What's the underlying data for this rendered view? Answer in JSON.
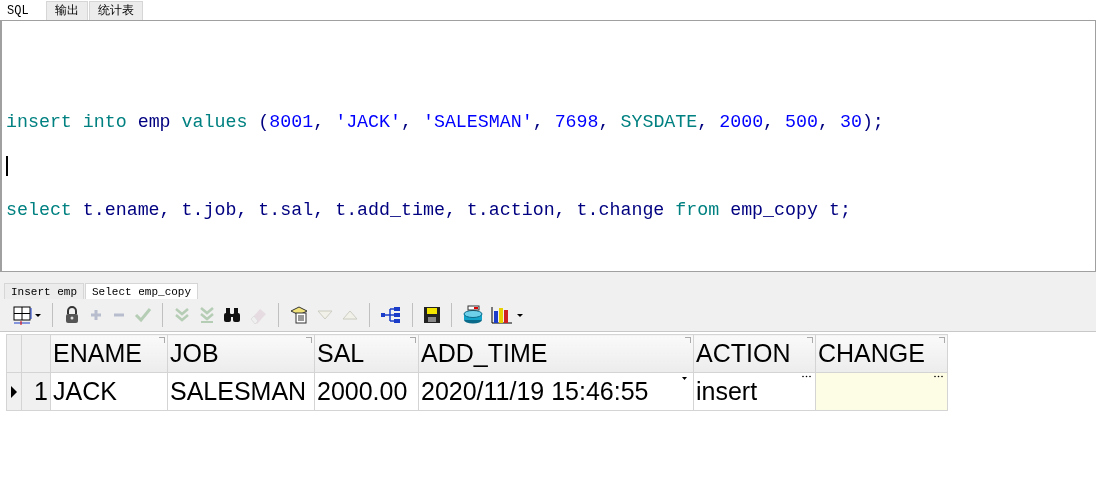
{
  "editor_tabs": [
    {
      "label": "SQL",
      "selected": true
    },
    {
      "label": "输出",
      "selected": false
    },
    {
      "label": "统计表",
      "selected": false
    }
  ],
  "editor": {
    "lines": [
      {
        "cursor": false,
        "tokens": [
          {
            "kind": "keyword",
            "text": "insert "
          },
          {
            "kind": "keyword",
            "text": "into "
          },
          {
            "kind": "ident",
            "text": "emp "
          },
          {
            "kind": "keyword",
            "text": "values "
          },
          {
            "kind": "punct",
            "text": "("
          },
          {
            "kind": "number",
            "text": "8001"
          },
          {
            "kind": "punct",
            "text": ", "
          },
          {
            "kind": "string",
            "text": "'JACK'"
          },
          {
            "kind": "punct",
            "text": ", "
          },
          {
            "kind": "string",
            "text": "'SALESMAN'"
          },
          {
            "kind": "punct",
            "text": ", "
          },
          {
            "kind": "number",
            "text": "7698"
          },
          {
            "kind": "punct",
            "text": ", "
          },
          {
            "kind": "keyword",
            "text": "SYSDATE"
          },
          {
            "kind": "punct",
            "text": ", "
          },
          {
            "kind": "number",
            "text": "2000"
          },
          {
            "kind": "punct",
            "text": ", "
          },
          {
            "kind": "number",
            "text": "500"
          },
          {
            "kind": "punct",
            "text": ", "
          },
          {
            "kind": "number",
            "text": "30"
          },
          {
            "kind": "punct",
            "text": ");"
          }
        ]
      },
      {
        "cursor": false
      },
      {
        "cursor": true
      },
      {
        "cursor": false
      },
      {
        "cursor": false,
        "tokens": [
          {
            "kind": "keyword",
            "text": "select "
          },
          {
            "kind": "ident",
            "text": "t.ename"
          },
          {
            "kind": "punct",
            "text": ", "
          },
          {
            "kind": "ident",
            "text": "t.job"
          },
          {
            "kind": "punct",
            "text": ", "
          },
          {
            "kind": "ident",
            "text": "t.sal"
          },
          {
            "kind": "punct",
            "text": ", "
          },
          {
            "kind": "ident",
            "text": "t.add_time"
          },
          {
            "kind": "punct",
            "text": ", "
          },
          {
            "kind": "ident",
            "text": "t.action"
          },
          {
            "kind": "punct",
            "text": ", "
          },
          {
            "kind": "ident",
            "text": "t.change "
          },
          {
            "kind": "keyword",
            "text": "from "
          },
          {
            "kind": "ident",
            "text": "emp_copy t"
          },
          {
            "kind": "punct",
            "text": ";"
          }
        ]
      }
    ]
  },
  "result_tabs": [
    {
      "label": "Insert emp",
      "selected": false
    },
    {
      "label": "Select emp_copy",
      "selected": true
    }
  ],
  "toolbar": [
    {
      "kind": "grid-menu",
      "disabled": false
    },
    {
      "kind": "separator"
    },
    {
      "kind": "lock",
      "disabled": false
    },
    {
      "kind": "plus",
      "disabled": true
    },
    {
      "kind": "minus",
      "disabled": true
    },
    {
      "kind": "check",
      "disabled": true
    },
    {
      "kind": "separator"
    },
    {
      "kind": "double-down",
      "disabled": true
    },
    {
      "kind": "double-down-bar",
      "disabled": true
    },
    {
      "kind": "binoculars",
      "disabled": false
    },
    {
      "kind": "eraser",
      "disabled": true
    },
    {
      "kind": "separator"
    },
    {
      "kind": "documents",
      "disabled": false
    },
    {
      "kind": "triangle-down",
      "disabled": true
    },
    {
      "kind": "triangle-up",
      "disabled": true
    },
    {
      "kind": "separator"
    },
    {
      "kind": "tree",
      "disabled": false
    },
    {
      "kind": "separator"
    },
    {
      "kind": "save",
      "disabled": false
    },
    {
      "kind": "separator"
    },
    {
      "kind": "database",
      "disabled": false
    },
    {
      "kind": "chart-menu",
      "disabled": false
    }
  ],
  "grid": {
    "columns": [
      "ENAME",
      "JOB",
      "SAL",
      "ADD_TIME",
      "ACTION",
      "CHANGE"
    ],
    "rows": [
      {
        "number": "1",
        "current": true,
        "cells": [
          {
            "kind": "plain",
            "text": "JACK",
            "null": false
          },
          {
            "kind": "plain",
            "text": "SALESMAN",
            "null": false
          },
          {
            "kind": "plain",
            "text": "2000.00",
            "null": false
          },
          {
            "kind": "dropdown",
            "text": "2020/11/19 15:46:55",
            "null": false
          },
          {
            "kind": "ellipsis",
            "text": "insert",
            "null": false
          },
          {
            "kind": "ellipsis",
            "null": true
          }
        ]
      }
    ]
  }
}
